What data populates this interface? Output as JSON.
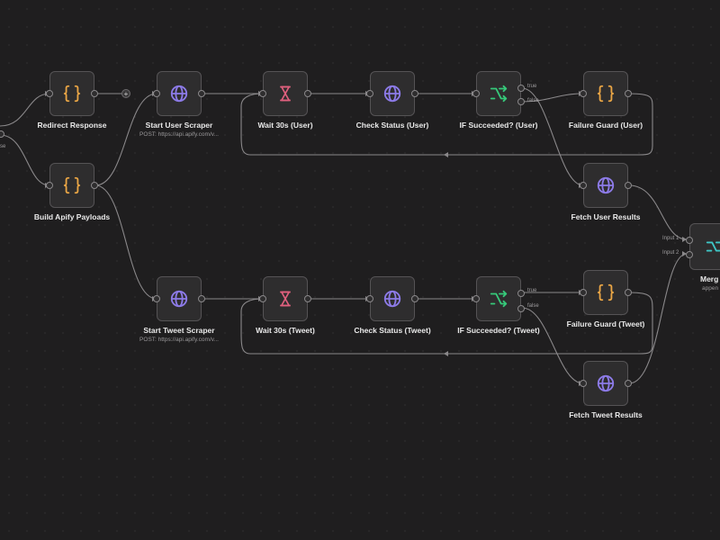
{
  "colors": {
    "background": "#1f1e1f",
    "edge": "#8a888a",
    "code_icon": "#e9a545",
    "http_icon": "#8d7be8",
    "wait_icon": "#e0607e",
    "if_icon": "#36c97a",
    "merge_icon": "#3ec6c6"
  },
  "edge_fragment": "se",
  "nodes": {
    "redirect_response": {
      "label": "Redirect Response",
      "icon": "code-braces-icon"
    },
    "build_apify_payloads": {
      "label": "Build Apify Payloads",
      "icon": "code-braces-icon"
    },
    "start_user_scraper": {
      "label": "Start User Scraper",
      "subtitle": "POST: https://api.apify.com/v...",
      "icon": "globe-icon"
    },
    "wait_user": {
      "label": "Wait 30s (User)",
      "icon": "hourglass-icon"
    },
    "check_status_user": {
      "label": "Check Status (User)",
      "icon": "globe-icon"
    },
    "if_succeeded_user": {
      "label": "IF Succeeded? (User)",
      "icon": "branch-icon",
      "true_label": "true",
      "false_label": "false"
    },
    "failure_guard_user": {
      "label": "Failure Guard (User)",
      "icon": "code-braces-icon"
    },
    "fetch_user_results": {
      "label": "Fetch User Results",
      "icon": "globe-icon"
    },
    "start_tweet_scraper": {
      "label": "Start Tweet Scraper",
      "subtitle": "POST: https://api.apify.com/v...",
      "icon": "globe-icon"
    },
    "wait_tweet": {
      "label": "Wait 30s (Tweet)",
      "icon": "hourglass-icon"
    },
    "check_status_tweet": {
      "label": "Check Status (Tweet)",
      "icon": "globe-icon"
    },
    "if_succeeded_tweet": {
      "label": "IF Succeeded? (Tweet)",
      "icon": "branch-icon",
      "true_label": "true",
      "false_label": "false"
    },
    "failure_guard_tweet": {
      "label": "Failure Guard (Tweet)",
      "icon": "code-braces-icon"
    },
    "fetch_tweet_results": {
      "label": "Fetch Tweet Results",
      "icon": "globe-icon"
    },
    "merge": {
      "label": "Merg",
      "subtitle": "appen",
      "icon": "merge-icon",
      "input1": "Input 1",
      "input2": "Input 2"
    }
  }
}
